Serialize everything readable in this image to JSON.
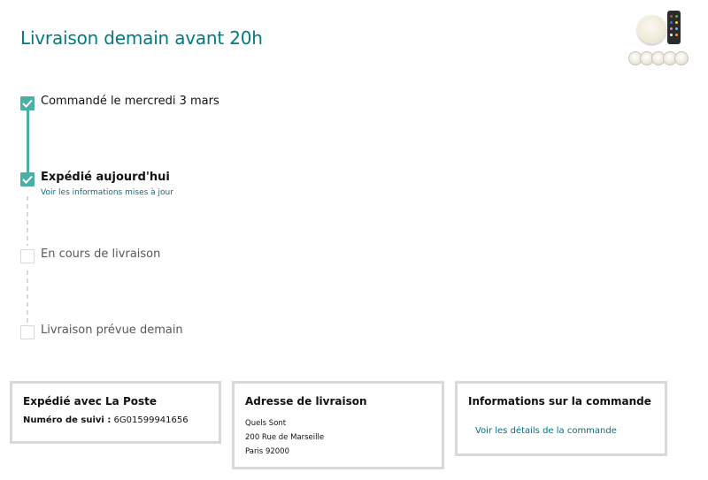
{
  "header": {
    "title": "Livraison demain avant 20h"
  },
  "product": {
    "thumbnail_icon": "led-puck-lights-with-remote-icon"
  },
  "timeline": {
    "steps": [
      {
        "label": "Commandé le mercredi 3 mars",
        "status": "done"
      },
      {
        "label": "Expédié aujourd'hui",
        "status": "done",
        "link": "Voir les informations mises à jour"
      },
      {
        "label": "En cours de livraison",
        "status": "pending"
      },
      {
        "label": "Livraison prévue demain",
        "status": "pending"
      }
    ],
    "accent_color": "#48b0a5"
  },
  "cards": {
    "shipping": {
      "title": "Expédié avec La Poste",
      "tracking_label": "Numéro de suivi :",
      "tracking_number": "6G01599941656"
    },
    "address": {
      "title": "Adresse de livraison",
      "lines": [
        "Quels Sont",
        "200 Rue de Marseille",
        "Paris 92000"
      ]
    },
    "order": {
      "title": "Informations sur la commande",
      "link": "Voir les détails de la commande"
    }
  },
  "colors": {
    "title": "#007b7f",
    "link": "#007185",
    "border": "#d5d9d9"
  }
}
